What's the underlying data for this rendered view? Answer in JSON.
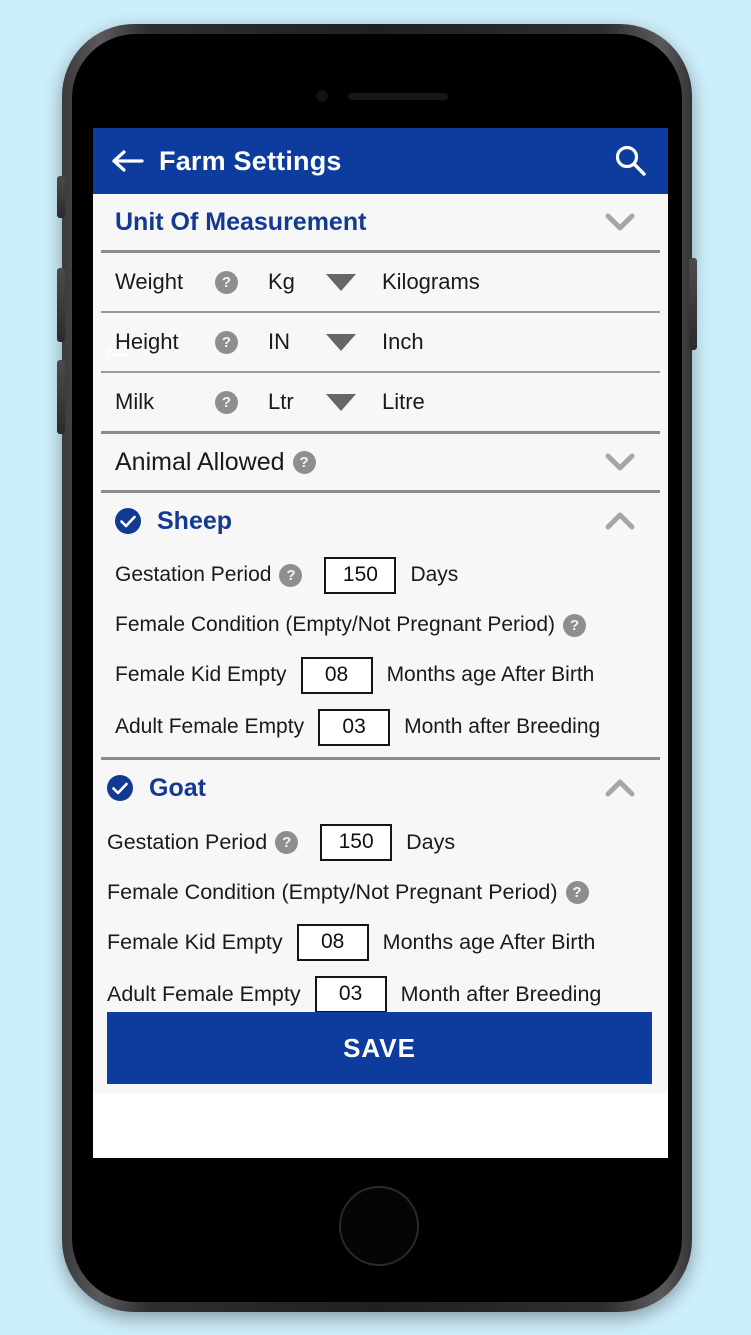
{
  "app_bar": {
    "title": "Farm Settings",
    "back_icon": "arrow-left-icon",
    "search_icon": "search-icon",
    "background_color": "#0d3c9e"
  },
  "unit_section": {
    "title": "Unit Of Measurement",
    "collapse_icon": "chevron-down-icon",
    "help_glyph": "?",
    "rows": [
      {
        "label": "Weight",
        "abbr": "Kg",
        "full": "Kilograms"
      },
      {
        "label": "Height",
        "abbr": "IN",
        "full": "Inch"
      },
      {
        "label": "Milk",
        "abbr": "Ltr",
        "full": "Litre"
      }
    ]
  },
  "animal_allowed": {
    "title": "Animal Allowed",
    "collapse_icon": "chevron-down-icon"
  },
  "animals": [
    {
      "name": "Sheep",
      "checked": true,
      "collapse_icon": "chevron-up-icon",
      "gestation_label": "Gestation Period",
      "gestation_value": "150",
      "gestation_unit": "Days",
      "condition_label": "Female Condition (Empty/Not Pregnant Period)",
      "kid_label": "Female Kid Empty",
      "kid_value": "08",
      "kid_unit": "Months age After Birth",
      "adult_label": "Adult Female Empty",
      "adult_value": "03",
      "adult_unit": "Month after Breeding"
    },
    {
      "name": "Goat",
      "checked": true,
      "collapse_icon": "chevron-up-icon",
      "gestation_label": "Gestation Period",
      "gestation_value": "150",
      "gestation_unit": "Days",
      "condition_label": "Female Condition (Empty/Not Pregnant Period)",
      "kid_label": "Female Kid Empty",
      "kid_value": "08",
      "kid_unit": "Months age After Birth",
      "adult_label": "Adult Female Empty",
      "adult_value": "03",
      "adult_unit": "Month after Breeding"
    }
  ],
  "save": {
    "label": "SAVE"
  },
  "theme": {
    "accent_blue": "#0d3c9e",
    "title_blue": "#123a92",
    "page_background": "#cdeefb",
    "content_background": "#f7f7f7",
    "help_icon_gray": "#8e8e8e"
  }
}
